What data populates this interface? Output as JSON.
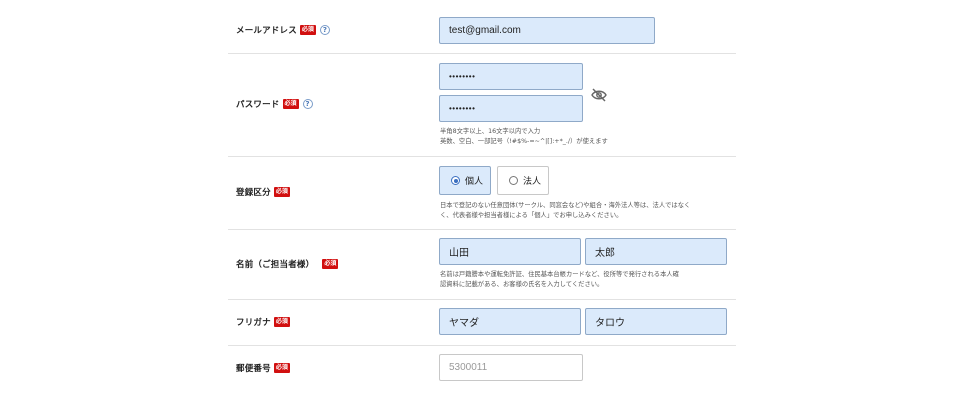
{
  "required_badge": "必須",
  "help_glyph": "?",
  "email": {
    "label": "メールアドレス",
    "value": "test@gmail.com"
  },
  "password": {
    "label": "パスワード",
    "value": "••••••••",
    "confirm_value": "••••••••",
    "hint_line1": "半角8文字以上、16文字以内で入力",
    "hint_line2": "英数、空白、一部記号（!#$%-=~^|[]:+*_./）が使えます",
    "toggle_icon": "eye-slash-icon"
  },
  "registration_type": {
    "label": "登録区分",
    "options": [
      {
        "label": "個人",
        "selected": true
      },
      {
        "label": "法人",
        "selected": false
      }
    ],
    "hint_line1": "日本で登記のない任意団体(サークル、同窓会など)や組合・海外法人等は、法人ではなく",
    "hint_line2": "く、代表者様や担当者様による「個人」でお申し込みください。"
  },
  "name": {
    "label": "名前（ご担当者様）",
    "last_name": "山田",
    "first_name": "太郎",
    "hint_line1": "名前は戸籍謄本や運転免許証、住民基本台帳カードなど、役所等で発行される本人確",
    "hint_line2": "認資料に記載がある、お客様の氏名を入力してください。"
  },
  "furigana": {
    "label": "フリガナ",
    "last_name": "ヤマダ",
    "first_name": "タロウ"
  },
  "postal_code": {
    "label": "郵便番号",
    "placeholder": "5300011"
  }
}
